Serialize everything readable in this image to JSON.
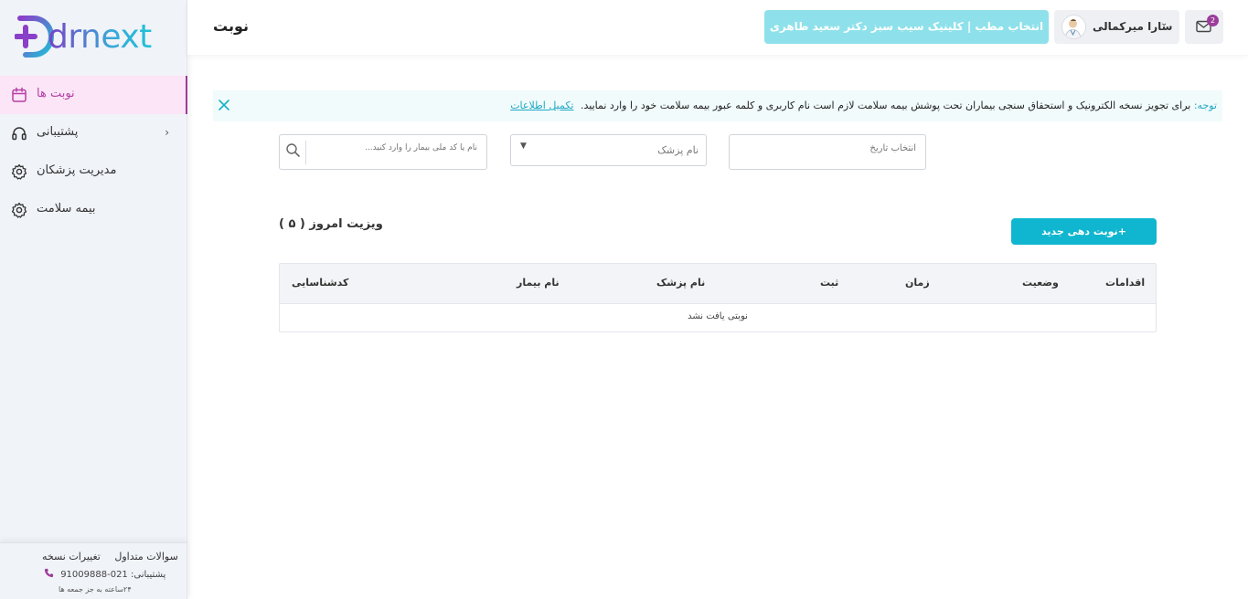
{
  "brand": {
    "name": "drnext",
    "colors": {
      "purple": "#9c3d9a",
      "teal": "#10b6cf",
      "light_teal": "#8ee1ea"
    }
  },
  "sidebar": {
    "items": [
      {
        "label": "نوبت ها",
        "icon": "calendar-icon",
        "active": true
      },
      {
        "label": "پشتیبانی",
        "icon": "headset-icon",
        "has_submenu": true
      },
      {
        "label": "مدیریت پزشکان",
        "icon": "gear-icon"
      },
      {
        "label": "بیمه سلامت",
        "icon": "gear-icon"
      }
    ],
    "footer": {
      "faq": "سوالات متداول",
      "changelog": "تغییرات نسخه",
      "support_label": "پشتیبانی:",
      "support_phone": "021-91009888",
      "hours": "۲۴ساعته به جز جمعه ها"
    }
  },
  "header": {
    "title": "نوبت",
    "clinic_button": "انتخاب مطب | کلینیک سیب سبز دکتر سعید طاهری",
    "user_name": "سارا میرکمالی",
    "mail_badge": "2"
  },
  "notice": {
    "label": "توجه:",
    "text": "برای تجویز نسخه الکترونیک و استحقاق سنجی بیماران تحت پوشش بیمه سلامت لازم است نام کاربری و کلمه عبور بیمه سلامت خود را وارد نمایید.",
    "link": "تکمیل اطلاعات"
  },
  "filters": {
    "date_placeholder": "انتخاب تاریخ",
    "doctor_placeholder": "نام پزشک",
    "search_placeholder": "نام یا کد ملی بیمار را وارد کنید..."
  },
  "visits": {
    "title": "ویزیت امروز ( ۵ )",
    "new_button": "+نوبت دهی جدید"
  },
  "table": {
    "columns": [
      "کدشناسایی",
      "نام بیمار",
      "نام پزشک",
      "ثبت",
      "زمان",
      "وضعیت",
      "اقدامات"
    ],
    "empty_message": "نوبتی یافت نشد"
  }
}
